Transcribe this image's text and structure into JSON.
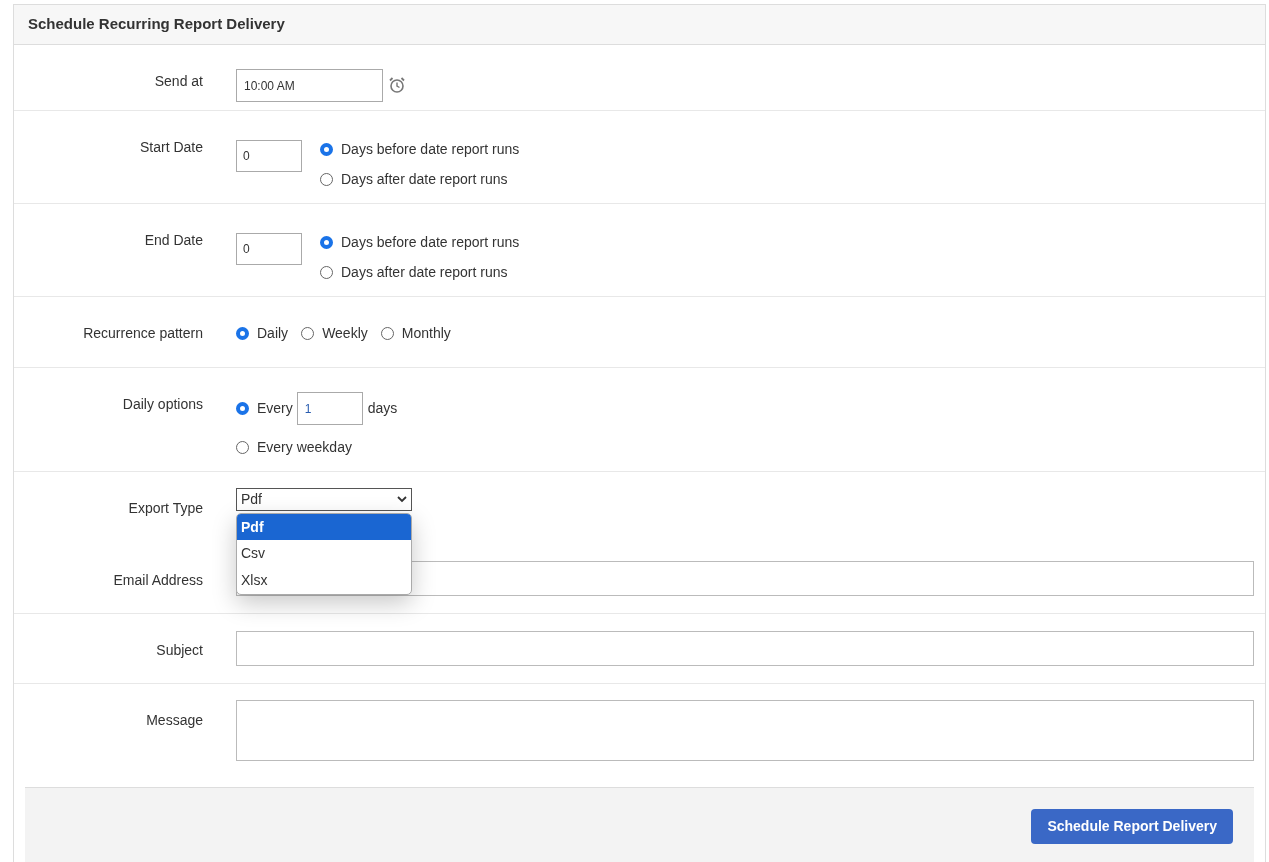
{
  "panel": {
    "title": "Schedule Recurring Report Delivery"
  },
  "rows": [
    {
      "kind": "time",
      "label": "Send at",
      "value": "10:00 AM"
    },
    {
      "kind": "offset",
      "label": "Start Date",
      "value": "0",
      "options": [
        {
          "label": "Days before date report runs",
          "selected": true
        },
        {
          "label": "Days after date report runs",
          "selected": false
        }
      ]
    },
    {
      "kind": "offset",
      "label": "End Date",
      "value": "0",
      "options": [
        {
          "label": "Days before date report runs",
          "selected": true
        },
        {
          "label": "Days after date report runs",
          "selected": false
        }
      ]
    },
    {
      "kind": "inline",
      "label": "Recurrence pattern",
      "options": [
        {
          "label": "Daily",
          "selected": true
        },
        {
          "label": "Weekly",
          "selected": false
        },
        {
          "label": "Monthly",
          "selected": false
        }
      ]
    },
    {
      "kind": "daily",
      "label": "Daily options",
      "options": [
        {
          "label": "Every",
          "value": "1",
          "suffix": "days",
          "selected": true
        },
        {
          "label": "Every weekday",
          "selected": false
        }
      ]
    },
    {
      "kind": "select",
      "label": "Export Type",
      "value": "Pdf",
      "expanded": true,
      "options": [
        {
          "label": "Pdf",
          "selected": true
        },
        {
          "label": "Csv",
          "selected": false
        },
        {
          "label": "Xlsx",
          "selected": false
        }
      ]
    },
    {
      "kind": "text",
      "label": "Email Address"
    },
    {
      "kind": "text",
      "label": "Subject"
    },
    {
      "kind": "textarea",
      "label": "Message"
    }
  ],
  "footer": {
    "button": "Schedule Report Delivery"
  }
}
